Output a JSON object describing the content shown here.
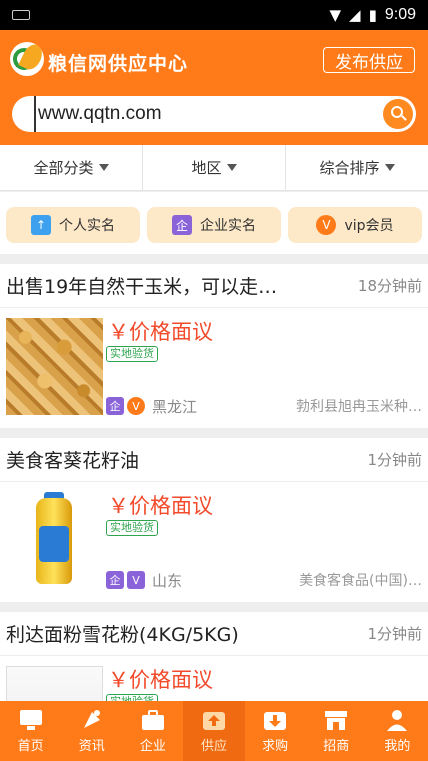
{
  "status_bar": {
    "time": "9:09"
  },
  "header": {
    "app_title": "粮信网供应中心",
    "publish_label": "发布供应",
    "search_value": "www.qqtn.com"
  },
  "filters": [
    {
      "label": "全部分类"
    },
    {
      "label": "地区"
    },
    {
      "label": "综合排序"
    }
  ],
  "badges": [
    {
      "icon": "person-badge-icon",
      "icon_text": "个",
      "label": "个人实名"
    },
    {
      "icon": "company-badge-icon",
      "icon_text": "企",
      "label": "企业实名"
    },
    {
      "icon": "vip-medal-icon",
      "icon_text": "V",
      "label": "vip会员"
    }
  ],
  "listings": [
    {
      "title": "出售19年自然干玉米，可以走…",
      "time": "18分钟前",
      "price": "￥价格面议",
      "tag": "实地验货",
      "region": "黑龙江",
      "company": "勃利县旭冉玉米种…"
    },
    {
      "title": "美食客葵花籽油",
      "time": "1分钟前",
      "price": "￥价格面议",
      "tag": "实地验货",
      "region": "山东",
      "company": "美食客食品(中国)…"
    },
    {
      "title": "利达面粉雪花粉(4KG/5KG)",
      "time": "1分钟前",
      "price": "￥价格面议",
      "tag": "实地验货",
      "region": "",
      "company": ""
    }
  ],
  "bottom_nav": [
    {
      "label": "首页",
      "icon": "monitor-icon"
    },
    {
      "label": "资讯",
      "icon": "satellite-icon"
    },
    {
      "label": "企业",
      "icon": "briefcase-icon"
    },
    {
      "label": "供应",
      "icon": "upload-box-icon",
      "active": true
    },
    {
      "label": "求购",
      "icon": "download-box-icon"
    },
    {
      "label": "招商",
      "icon": "store-icon"
    },
    {
      "label": "我的",
      "icon": "user-icon"
    }
  ],
  "colors": {
    "brand": "#ff7b1a",
    "price": "#f24a2a",
    "tag": "#2ea44f"
  }
}
